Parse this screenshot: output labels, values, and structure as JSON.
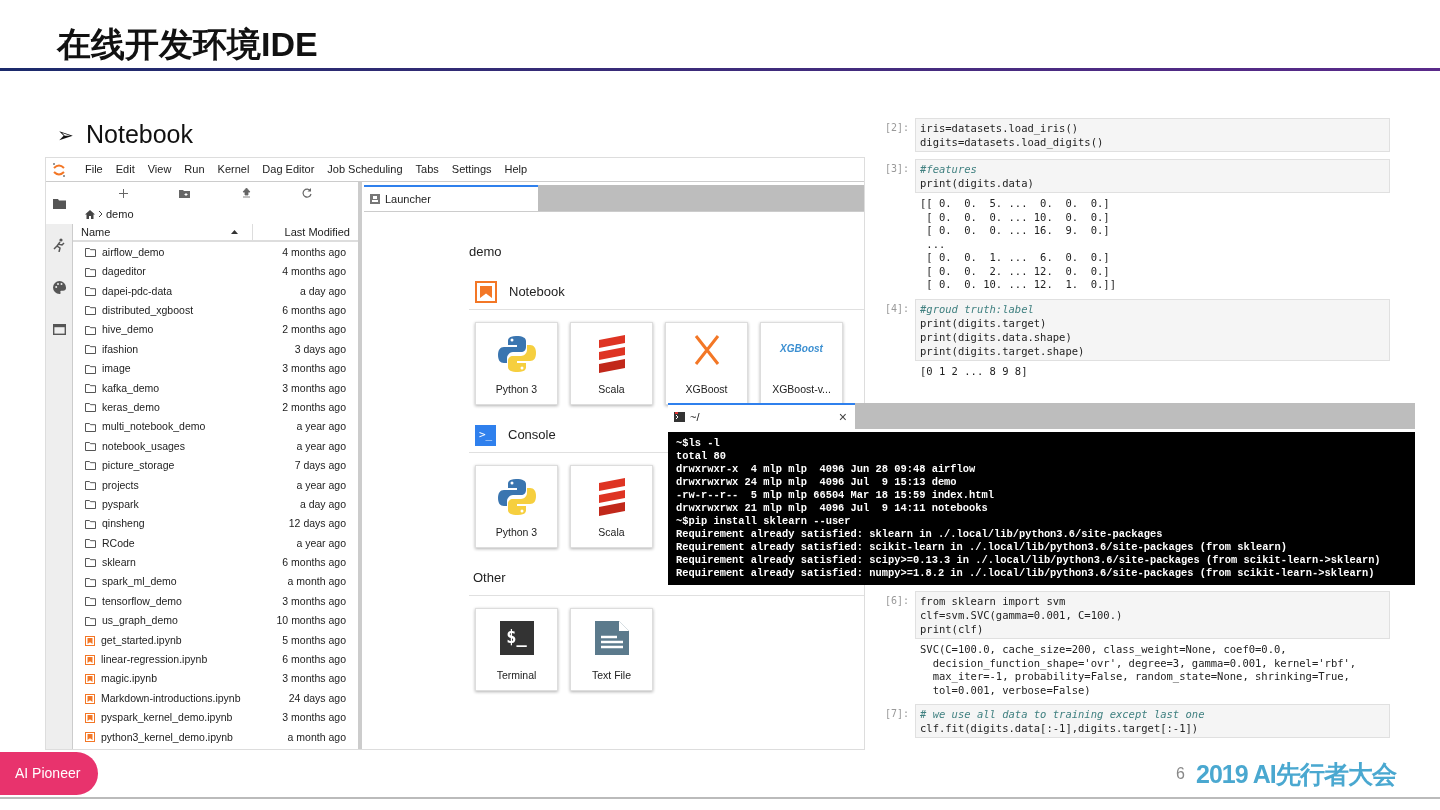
{
  "slide": {
    "title": "在线开发环境IDE",
    "bullet_marker": "➢",
    "bullet": "Notebook",
    "footer_badge": "AI Pioneer",
    "footer_logo": "2019 AI先行者大会",
    "page_number": "6"
  },
  "jupyter": {
    "menu": [
      "File",
      "Edit",
      "View",
      "Run",
      "Kernel",
      "Dag Editor",
      "Job Scheduling",
      "Tabs",
      "Settings",
      "Help"
    ],
    "sidebar_icons": [
      {
        "kind": "folder",
        "selected": true
      },
      {
        "kind": "runner",
        "selected": false
      },
      {
        "kind": "palette",
        "selected": false
      },
      {
        "kind": "tabs",
        "selected": false
      }
    ],
    "breadcrumb": "demo",
    "columns": [
      "Name",
      "Last Modified"
    ],
    "files": [
      {
        "name": "airflow_demo",
        "modified": "4 months ago",
        "kind": "folder"
      },
      {
        "name": "dageditor",
        "modified": "4 months ago",
        "kind": "folder"
      },
      {
        "name": "dapei-pdc-data",
        "modified": "a day ago",
        "kind": "folder"
      },
      {
        "name": "distributed_xgboost",
        "modified": "6 months ago",
        "kind": "folder"
      },
      {
        "name": "hive_demo",
        "modified": "2 months ago",
        "kind": "folder"
      },
      {
        "name": "ifashion",
        "modified": "3 days ago",
        "kind": "folder"
      },
      {
        "name": "image",
        "modified": "3 months ago",
        "kind": "folder"
      },
      {
        "name": "kafka_demo",
        "modified": "3 months ago",
        "kind": "folder"
      },
      {
        "name": "keras_demo",
        "modified": "2 months ago",
        "kind": "folder"
      },
      {
        "name": "multi_notebook_demo",
        "modified": "a year ago",
        "kind": "folder"
      },
      {
        "name": "notebook_usages",
        "modified": "a year ago",
        "kind": "folder"
      },
      {
        "name": "picture_storage",
        "modified": "7 days ago",
        "kind": "folder"
      },
      {
        "name": "projects",
        "modified": "a year ago",
        "kind": "folder"
      },
      {
        "name": "pyspark",
        "modified": "a day ago",
        "kind": "folder"
      },
      {
        "name": "qinsheng",
        "modified": "12 days ago",
        "kind": "folder"
      },
      {
        "name": "RCode",
        "modified": "a year ago",
        "kind": "folder"
      },
      {
        "name": "sklearn",
        "modified": "6 months ago",
        "kind": "folder"
      },
      {
        "name": "spark_ml_demo",
        "modified": "a month ago",
        "kind": "folder"
      },
      {
        "name": "tensorflow_demo",
        "modified": "3 months ago",
        "kind": "folder"
      },
      {
        "name": "us_graph_demo",
        "modified": "10 months ago",
        "kind": "folder"
      },
      {
        "name": "get_started.ipynb",
        "modified": "5 months ago",
        "kind": "notebook"
      },
      {
        "name": "linear-regression.ipynb",
        "modified": "6 months ago",
        "kind": "notebook"
      },
      {
        "name": "magic.ipynb",
        "modified": "3 months ago",
        "kind": "notebook"
      },
      {
        "name": "Markdown-introductions.ipynb",
        "modified": "24 days ago",
        "kind": "notebook"
      },
      {
        "name": "pyspark_kernel_demo.ipynb",
        "modified": "3 months ago",
        "kind": "notebook"
      },
      {
        "name": "python3_kernel_demo.ipynb",
        "modified": "a month ago",
        "kind": "notebook"
      }
    ],
    "tab": {
      "label": "Launcher",
      "selected": true
    },
    "launcher": {
      "path": "demo",
      "sections": [
        {
          "title": "Notebook",
          "kind": "notebook",
          "cards": [
            {
              "label": "Python 3",
              "kind": "python"
            },
            {
              "label": "Scala",
              "kind": "scala"
            },
            {
              "label": "XGBoost",
              "kind": "xgboost-x"
            },
            {
              "label": "XGBoost-v...",
              "kind": "xgboost-logo",
              "logo_text": "XGBoost"
            }
          ]
        },
        {
          "title": "Console",
          "kind": "console",
          "icon_text": ">_",
          "cards": [
            {
              "label": "Python 3",
              "kind": "python"
            },
            {
              "label": "Scala",
              "kind": "scala"
            }
          ]
        },
        {
          "title": "Other",
          "kind": "other",
          "cards": [
            {
              "label": "Terminal",
              "kind": "terminal",
              "logo_text": "$_"
            },
            {
              "label": "Text File",
              "kind": "textfile"
            }
          ]
        }
      ]
    }
  },
  "notebook_top": [
    {
      "prompt": "[2]:",
      "input": [
        {
          "text": "iris=datasets.load_iris()",
          "kind": "code"
        },
        {
          "text": "digits=datasets.load_digits()",
          "kind": "code"
        }
      ]
    },
    {
      "prompt": "[3]:",
      "input": [
        {
          "text": "#features",
          "kind": "comment"
        },
        {
          "text": "print(digits.data)",
          "kind": "code"
        }
      ],
      "output": [
        "[[ 0.  0.  5. ...  0.  0.  0.]",
        " [ 0.  0.  0. ... 10.  0.  0.]",
        " [ 0.  0.  0. ... 16.  9.  0.]",
        " ...",
        " [ 0.  0.  1. ...  6.  0.  0.]",
        " [ 0.  0.  2. ... 12.  0.  0.]",
        " [ 0.  0. 10. ... 12.  1.  0.]]"
      ]
    },
    {
      "prompt": "[4]:",
      "input": [
        {
          "text": "#groud truth:label",
          "kind": "comment"
        },
        {
          "text": "print(digits.target)",
          "kind": "code"
        },
        {
          "text": "print(digits.data.shape)",
          "kind": "code"
        },
        {
          "text": "print(digits.target.shape)",
          "kind": "code"
        }
      ],
      "output": [
        "[0 1 2 ... 8 9 8]"
      ]
    }
  ],
  "terminal": {
    "tab": "~/",
    "selected": true,
    "close": "×",
    "lines": [
      "~$ls -l",
      "total 80",
      "drwxrwxr-x  4 mlp mlp  4096 Jun 28 09:48 airflow",
      "drwxrwxrwx 24 mlp mlp  4096 Jul  9 15:13 demo",
      "-rw-r--r--  5 mlp mlp 66504 Mar 18 15:59 index.html",
      "drwxrwxrwx 21 mlp mlp  4096 Jul  9 14:11 notebooks",
      "~$pip install sklearn --user",
      "Requirement already satisfied: sklearn in ./.local/lib/python3.6/site-packages",
      "Requirement already satisfied: scikit-learn in ./.local/lib/python3.6/site-packages (from sklearn)",
      "Requirement already satisfied: scipy>=0.13.3 in ./.local/lib/python3.6/site-packages (from scikit-learn->sklearn)",
      "Requirement already satisfied: numpy>=1.8.2 in ./.local/lib/python3.6/site-packages (from scikit-learn->sklearn)"
    ]
  },
  "notebook_bottom": [
    {
      "prompt": "[6]:",
      "input": [
        {
          "text": "from sklearn import svm",
          "kind": "code"
        },
        {
          "text": "clf=svm.SVC(gamma=0.001, C=100.)",
          "kind": "code"
        },
        {
          "text": "print(clf)",
          "kind": "code"
        }
      ],
      "output": [
        "SVC(C=100.0, cache_size=200, class_weight=None, coef0=0.0,",
        "  decision_function_shape='ovr', degree=3, gamma=0.001, kernel='rbf',",
        "  max_iter=-1, probability=False, random_state=None, shrinking=True,",
        "  tol=0.001, verbose=False)"
      ]
    },
    {
      "prompt": "[7]:",
      "input": [
        {
          "text": "# we use all data to training except last one",
          "kind": "comment"
        },
        {
          "text": "clf.fit(digits.data[:-1],digits.target[:-1])",
          "kind": "code"
        }
      ]
    }
  ]
}
